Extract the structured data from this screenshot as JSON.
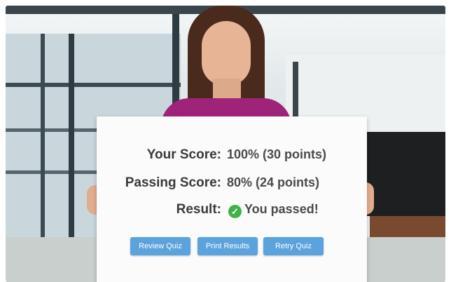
{
  "results": {
    "your_score_label": "Your Score:",
    "your_score_value": "100% (30 points)",
    "passing_score_label": "Passing Score:",
    "passing_score_value": "80% (24 points)",
    "result_label": "Result:",
    "result_value": "You passed!"
  },
  "buttons": {
    "review": "Review Quiz",
    "print": "Print Results",
    "retry": "Retry Quiz"
  },
  "colors": {
    "button": "#5aa3dc",
    "pass_icon": "#3fb24a",
    "blouse": "#a0237a"
  },
  "icons": {
    "result": "check-circle-icon"
  }
}
